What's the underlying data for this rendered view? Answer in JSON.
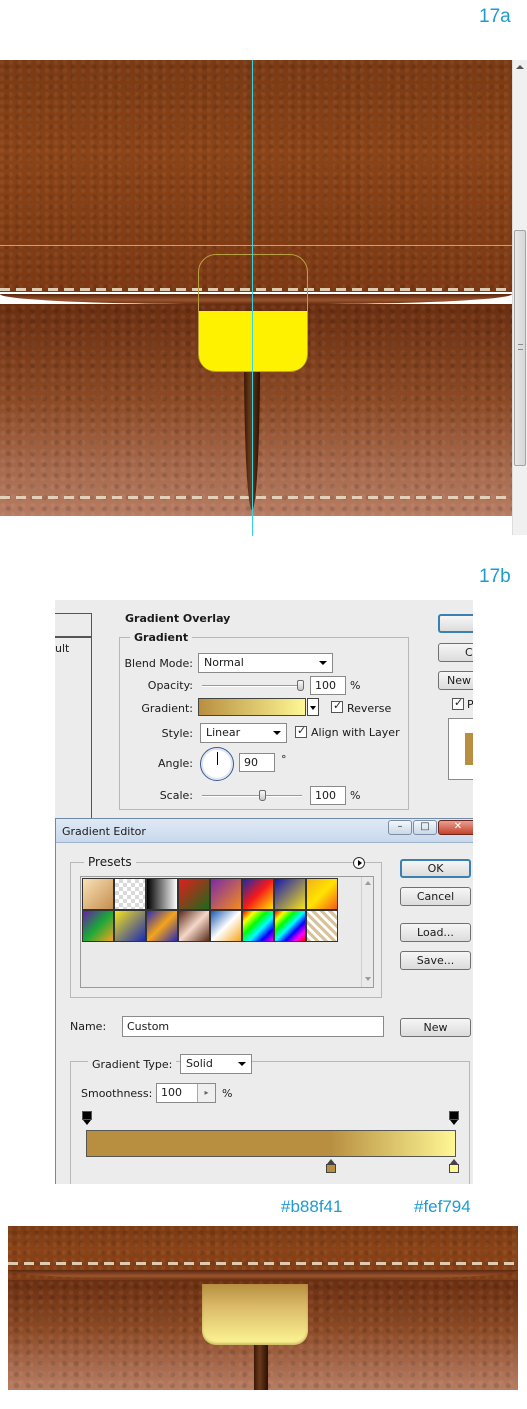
{
  "labels": {
    "step_a": "17a",
    "step_b": "17b"
  },
  "layer_style": {
    "section_title": "Gradient Overlay",
    "group_title": "Gradient",
    "blend_mode_label": "Blend Mode:",
    "blend_mode_value": "Normal",
    "opacity_label": "Opacity:",
    "opacity_value": "100",
    "opacity_unit": "%",
    "opacity_fraction": 1.0,
    "gradient_label": "Gradient:",
    "reverse_label": "Reverse",
    "reverse_checked": true,
    "style_label": "Style:",
    "style_value": "Linear",
    "align_label": "Align with Layer",
    "align_checked": true,
    "angle_label": "Angle:",
    "angle_value": "90",
    "angle_unit": "°",
    "scale_label": "Scale:",
    "scale_value": "100",
    "scale_unit": "%",
    "scale_fraction": 0.6,
    "left_partial_text": "ult",
    "right_buttons": {
      "btn2": "Ca",
      "btn3": "New",
      "preview_checked": true,
      "preview_partial": "P"
    }
  },
  "gradient_editor": {
    "window_title": "Gradient Editor",
    "presets_label": "Presets",
    "buttons": {
      "ok": "OK",
      "cancel": "Cancel",
      "load": "Load...",
      "save": "Save...",
      "new": "New"
    },
    "name_label": "Name:",
    "name_value": "Custom",
    "type_label": "Gradient Type:",
    "type_value": "Solid",
    "smoothness_label": "Smoothness:",
    "smoothness_value": "100",
    "smoothness_unit": "%",
    "presets": [
      "linear-gradient(135deg,#f8e2b8,#c68e4f)",
      "checker",
      "linear-gradient(90deg,#000,#fff)",
      "linear-gradient(135deg,#e11e1e,#1d6a1a)",
      "linear-gradient(135deg,#7a2aa8,#f58c1e)",
      "linear-gradient(135deg,#1a2aa8,#f51a1a,#ffe400)",
      "linear-gradient(135deg,#1616b4,#f5e41a)",
      "linear-gradient(135deg,#f5b01a,#ffe400,#f55a1a)",
      "linear-gradient(135deg,#6a1aa8,#1aa83a,#f5a41a)",
      "linear-gradient(135deg,#f5e41a,#1a2ab4)",
      "linear-gradient(135deg,#2a2ab4,#f5a41a,#2a2ab4)",
      "linear-gradient(135deg,#5a2a1a,#f5d8c8,#5a2a1a)",
      "linear-gradient(135deg,#1a5ab4,#ffffff,#f5a41a)",
      "linear-gradient(135deg,#ff0000,#ffff00,#00ff00,#00ffff,#0000ff,#ff00ff)",
      "linear-gradient(135deg,#ff0000,#ffff00,#00ff00,#00ffff,#0000ff,#ff00ff,#ff0000)",
      "checker-gold"
    ],
    "gradient_colors": [
      "#b88f41",
      "#fef794"
    ]
  },
  "color_hex": {
    "start": "#b88f41",
    "end": "#fef794"
  },
  "colors": {
    "leather": "#7c3913",
    "guide_line": "#37d3e0",
    "accent": "#1f9bd1",
    "yellow_fill": "#fff200"
  }
}
